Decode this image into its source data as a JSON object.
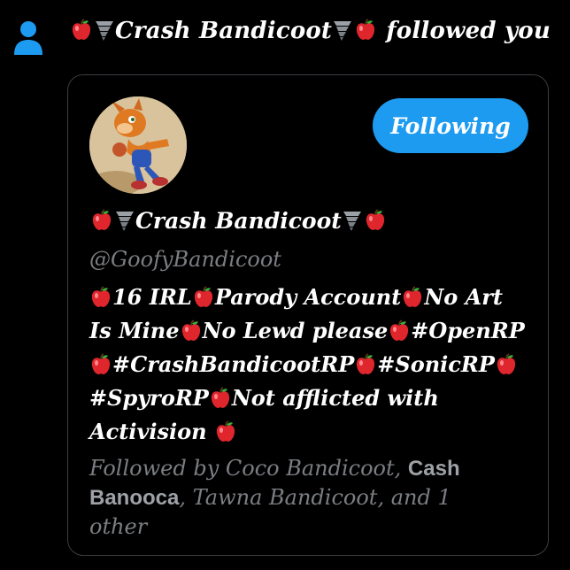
{
  "notification": {
    "icon": "person-icon",
    "account_name": "Crash Bandicoot",
    "action_text": "followed you"
  },
  "card": {
    "avatar_icon": "crash-bandicoot-avatar",
    "follow_button_label": "Following",
    "display_name": "Crash Bandicoot",
    "handle": "@GoofyBandicoot",
    "bio": {
      "part1": "16 IRL",
      "part2": "Parody Account",
      "part3": "No Art Is Mine",
      "part4": "No Lewd please",
      "part5": "#OpenRP",
      "part6": "#CrashBandicootRP",
      "part7": "#SonicRP",
      "part8": "#SpyroRP",
      "part9": "Not afflicted with Activision"
    },
    "followed_by": {
      "prefix": "Followed by",
      "name1": "Coco Bandicoot",
      "sep1": ", ",
      "name2": "Cash Banooca",
      "sep2": ", ",
      "name3": "Tawna Bandicoot",
      "suffix": ", and 1 other"
    }
  },
  "colors": {
    "background": "#000000",
    "accent": "#1d9bf0",
    "muted_text": "#7b7e82",
    "card_border": "#3a3d41"
  }
}
